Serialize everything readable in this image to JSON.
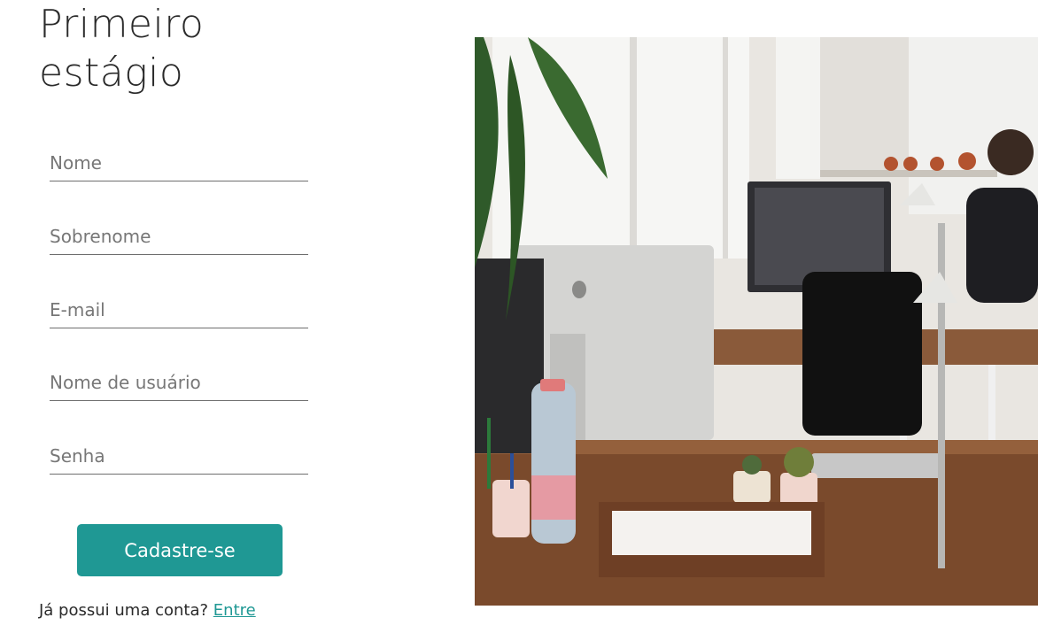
{
  "title": {
    "line1": "Primeiro",
    "line2": "estágio"
  },
  "form": {
    "fields": [
      {
        "placeholder": "Nome",
        "value": ""
      },
      {
        "placeholder": "Sobrenome",
        "value": ""
      },
      {
        "placeholder": "E-mail",
        "value": ""
      },
      {
        "placeholder": "Nome de usuário",
        "value": ""
      },
      {
        "placeholder": "Senha",
        "value": ""
      }
    ],
    "submit_label": "Cadastre-se"
  },
  "login": {
    "prompt": "Já possui uma conta?",
    "link_label": "Entre"
  },
  "colors": {
    "accent": "#1f9894",
    "text": "#2a2a2a"
  }
}
